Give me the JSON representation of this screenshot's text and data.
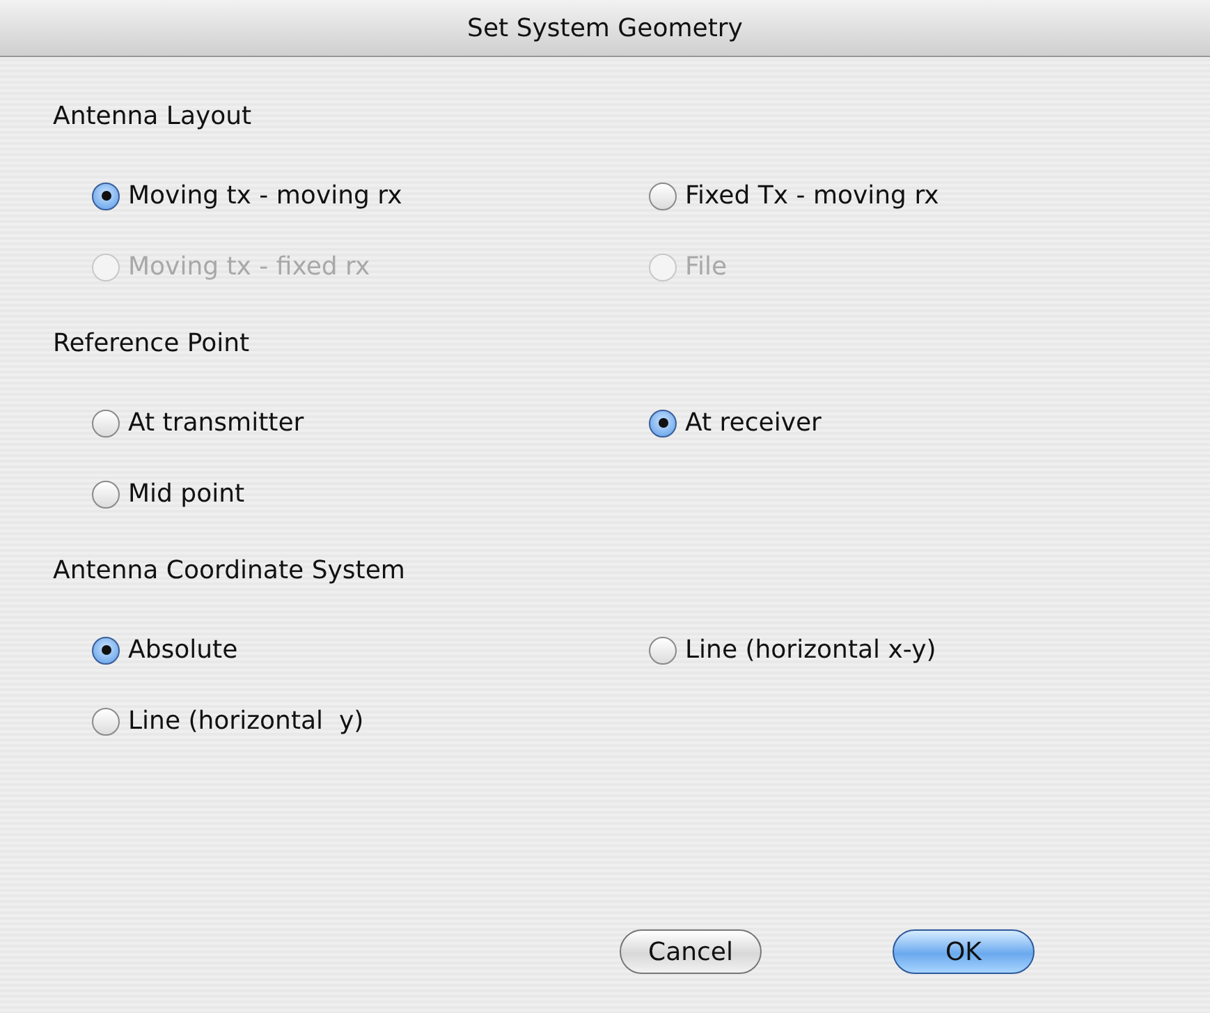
{
  "window": {
    "title": "Set System Geometry"
  },
  "sections": [
    {
      "title": "Antenna Layout",
      "options": [
        {
          "label": "Moving tx - moving rx",
          "selected": true,
          "disabled": false
        },
        {
          "label": "Fixed Tx - moving rx",
          "selected": false,
          "disabled": false
        },
        {
          "label": "Moving tx - fixed rx",
          "selected": false,
          "disabled": true
        },
        {
          "label": "File",
          "selected": false,
          "disabled": true
        }
      ]
    },
    {
      "title": "Reference Point",
      "options": [
        {
          "label": "At transmitter",
          "selected": false,
          "disabled": false
        },
        {
          "label": "At receiver",
          "selected": true,
          "disabled": false
        },
        {
          "label": "Mid point",
          "selected": false,
          "disabled": false
        }
      ]
    },
    {
      "title": "Antenna Coordinate System",
      "options": [
        {
          "label": "Absolute",
          "selected": true,
          "disabled": false
        },
        {
          "label": "Line (horizontal x-y)",
          "selected": false,
          "disabled": false
        },
        {
          "label": "Line (horizontal  y)",
          "selected": false,
          "disabled": false
        }
      ]
    }
  ],
  "buttons": [
    {
      "label": "Cancel",
      "default": false
    },
    {
      "label": "OK",
      "default": true
    }
  ]
}
